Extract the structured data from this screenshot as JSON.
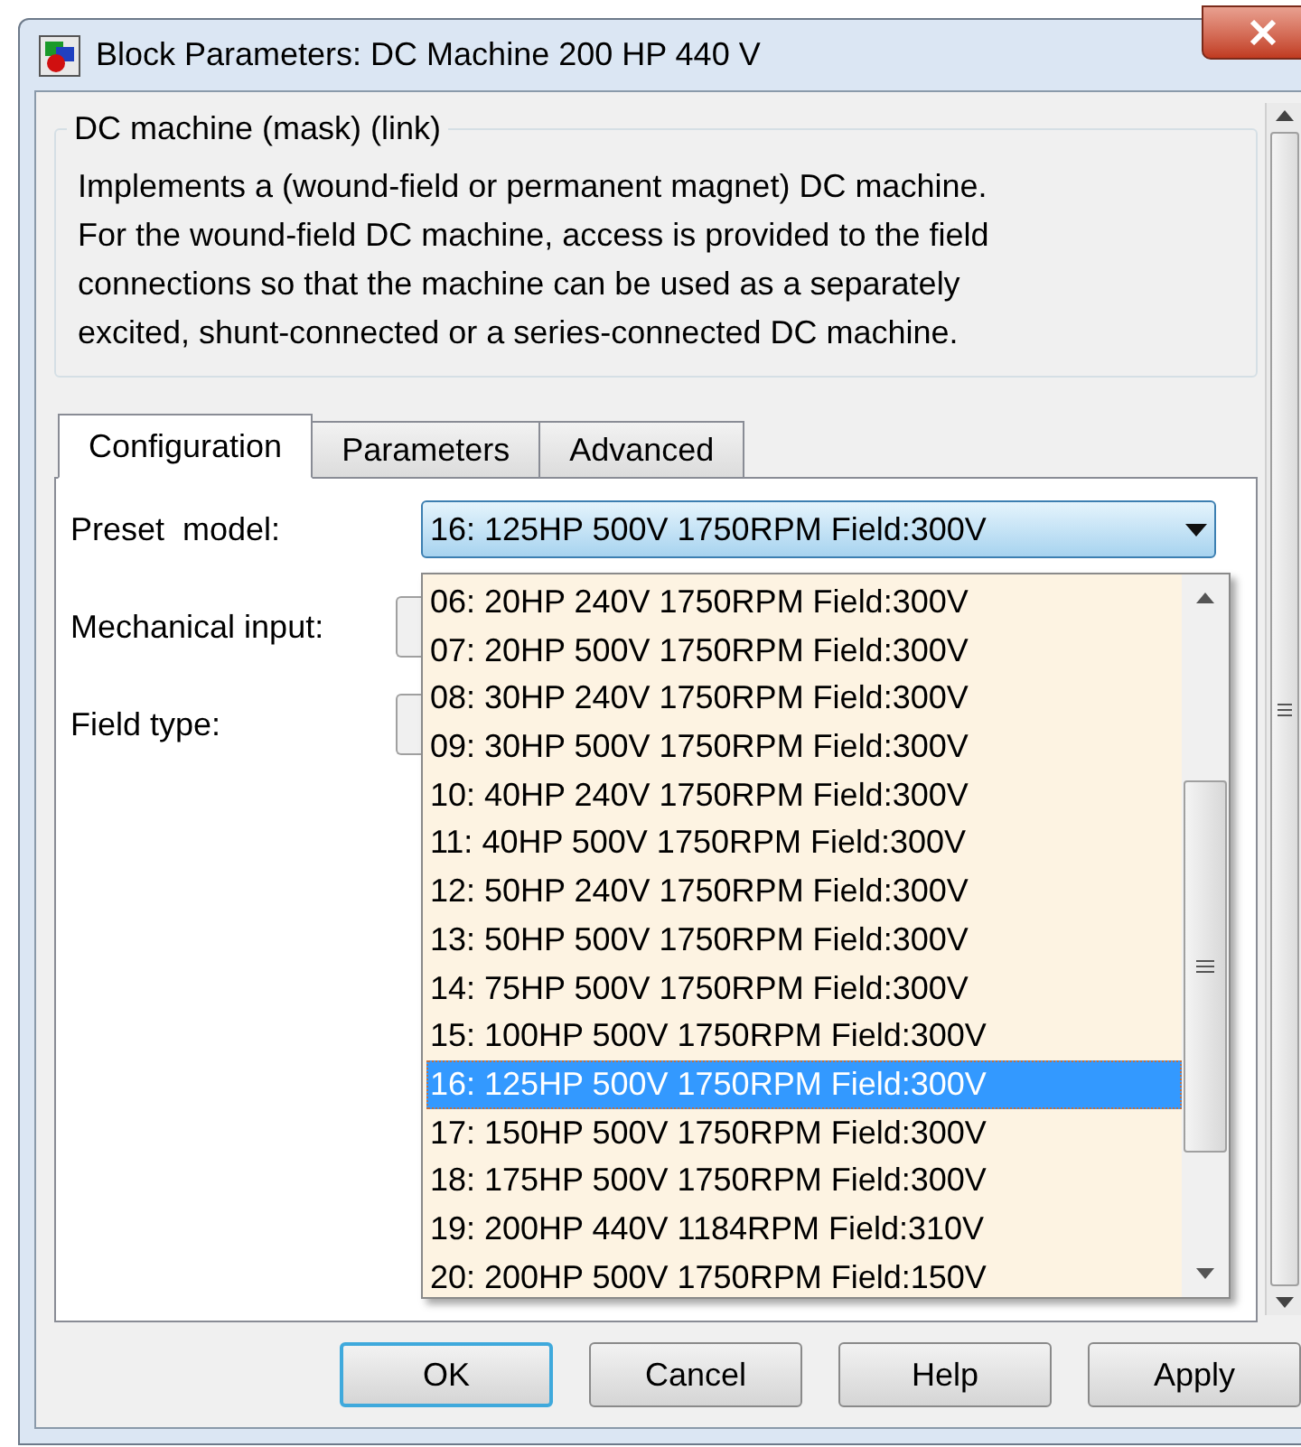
{
  "window": {
    "title": "Block Parameters: DC Machine 200 HP 440 V"
  },
  "group": {
    "title": "DC machine (mask) (link)",
    "description_lines": [
      "Implements a (wound-field or permanent magnet) DC machine.",
      "For the wound-field DC machine, access is provided to the field",
      "connections so that the machine can be used as a separately",
      "excited, shunt-connected or a series-connected  DC machine."
    ]
  },
  "tabs": [
    {
      "label": "Configuration",
      "selected": true
    },
    {
      "label": "Parameters",
      "selected": false
    },
    {
      "label": "Advanced",
      "selected": false
    }
  ],
  "fields": [
    {
      "label": "Preset  model:",
      "kind": "dropdown",
      "value": "16: 125HP 500V 1750RPM Field:300V",
      "expanded": true
    },
    {
      "label": "Mechanical input:",
      "kind": "dropdown"
    },
    {
      "label": "Field type:",
      "kind": "dropdown"
    }
  ],
  "dropdown_options": [
    {
      "label": "06: 20HP 240V 1750RPM Field:300V",
      "selected": false
    },
    {
      "label": "07: 20HP 500V 1750RPM Field:300V",
      "selected": false
    },
    {
      "label": "08: 30HP 240V 1750RPM Field:300V",
      "selected": false
    },
    {
      "label": "09: 30HP 500V 1750RPM Field:300V",
      "selected": false
    },
    {
      "label": "10: 40HP 240V 1750RPM Field:300V",
      "selected": false
    },
    {
      "label": "11: 40HP 500V 1750RPM Field:300V",
      "selected": false
    },
    {
      "label": "12: 50HP 240V 1750RPM Field:300V",
      "selected": false
    },
    {
      "label": "13: 50HP 500V 1750RPM Field:300V",
      "selected": false
    },
    {
      "label": "14: 75HP 500V 1750RPM Field:300V",
      "selected": false
    },
    {
      "label": "15: 100HP 500V 1750RPM Field:300V",
      "selected": false
    },
    {
      "label": "16: 125HP 500V 1750RPM Field:300V",
      "selected": true
    },
    {
      "label": "17: 150HP 500V 1750RPM Field:300V",
      "selected": false
    },
    {
      "label": "18: 175HP 500V 1750RPM Field:300V",
      "selected": false
    },
    {
      "label": "19: 200HP 440V 1184RPM Field:310V",
      "selected": false
    },
    {
      "label": "20: 200HP 500V 1750RPM Field:150V",
      "selected": false
    }
  ],
  "buttons": [
    {
      "label": "OK",
      "default": true
    },
    {
      "label": "Cancel",
      "default": false
    },
    {
      "label": "Help",
      "default": false
    },
    {
      "label": "Apply",
      "default": false
    }
  ]
}
